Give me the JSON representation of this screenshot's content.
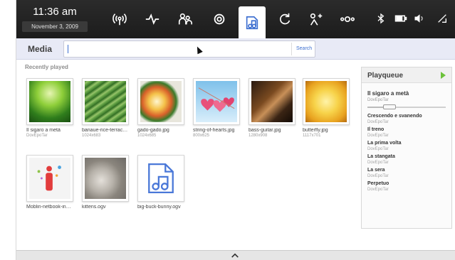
{
  "clock": {
    "time": "11:36 am",
    "date": "November 3, 2009"
  },
  "toolbar": {
    "icons": [
      "wireless-icon",
      "activity-icon",
      "people-icon",
      "settings-icon",
      "media-icon",
      "refresh-icon",
      "share-icon",
      "network-icon",
      "bluetooth-icon",
      "battery-icon",
      "volume-icon",
      "signal-icon"
    ],
    "active": "media-icon"
  },
  "media": {
    "section_title": "Media",
    "search_value": "",
    "search_button": "Search",
    "recent_label": "Recently played"
  },
  "items": [
    {
      "name": "Il sigaro a metà",
      "meta": "DovEpoTar",
      "img": "forest"
    },
    {
      "name": "banaue-rice-terrac…",
      "meta": "1024x683",
      "img": "rice"
    },
    {
      "name": "gado-gado.jpg",
      "meta": "1024x685",
      "img": "gado"
    },
    {
      "name": "string-of-hearts.jpg",
      "meta": "800x625",
      "img": "hearts"
    },
    {
      "name": "bass-guitar.jpg",
      "meta": "1280x908",
      "img": "guitar"
    },
    {
      "name": "butterfly.jpg",
      "meta": "1117x701",
      "img": "butterfly"
    },
    {
      "name": "Moblin-netbook-in…",
      "meta": "",
      "img": "moblin"
    },
    {
      "name": "kittens.ogv",
      "meta": "",
      "img": "kittens"
    },
    {
      "name": "big-buck-bunny.ogv",
      "meta": "",
      "img": "video"
    }
  ],
  "playqueue": {
    "title": "Playqueue",
    "now_playing": {
      "title": "Il sigaro a metà",
      "artist": "DovEpoTar",
      "progress": 0.2
    },
    "queue": [
      {
        "title": "Crescendo e svanendo",
        "artist": "DovEpoTar"
      },
      {
        "title": "Il treno",
        "artist": "DovEpoTar"
      },
      {
        "title": "La prima volta",
        "artist": "DovEpoTar"
      },
      {
        "title": "La stangata",
        "artist": "DovEpoTar"
      },
      {
        "title": "La sera",
        "artist": "DovEpoTar"
      },
      {
        "title": "Perpetuo",
        "artist": "DovEpoTar"
      }
    ]
  },
  "colors": {
    "accent": "#3d6fd0",
    "play": "#6cc23a",
    "topbar": "#222222"
  }
}
